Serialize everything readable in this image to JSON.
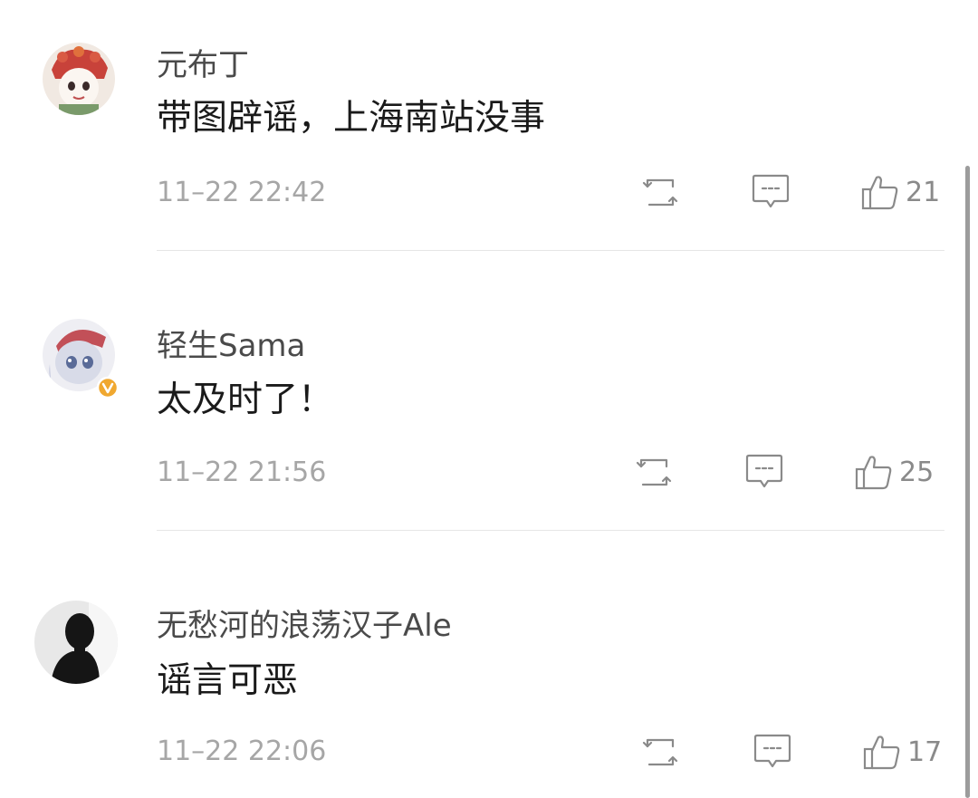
{
  "comments": [
    {
      "username": "元布丁",
      "text": "带图辟谣，上海南站没事",
      "time": "11–22 22:42",
      "repost_icon": "repost-icon",
      "comment_icon": "comment-icon",
      "like_icon": "thumbs-up-icon",
      "likes": "21"
    },
    {
      "username": "轻生Sama",
      "text": "太及时了！",
      "time": "11–22 21:56",
      "verified_badge": "verified-v-badge",
      "repost_icon": "repost-icon",
      "comment_icon": "comment-icon",
      "like_icon": "thumbs-up-icon",
      "likes": "25"
    },
    {
      "username": "无愁河的浪荡汉子Ale",
      "text": "谣言可恶",
      "time": "11–22 22:06",
      "repost_icon": "repost-icon",
      "comment_icon": "comment-icon",
      "like_icon": "thumbs-up-icon",
      "likes": "17"
    }
  ],
  "colors": {
    "verified_badge": "#f0a830",
    "text_primary": "#1a1a1a",
    "text_secondary": "#4a4a4a",
    "text_muted": "#a6a6a6",
    "icon": "#8a8a8a",
    "divider": "#e6e6e6"
  }
}
